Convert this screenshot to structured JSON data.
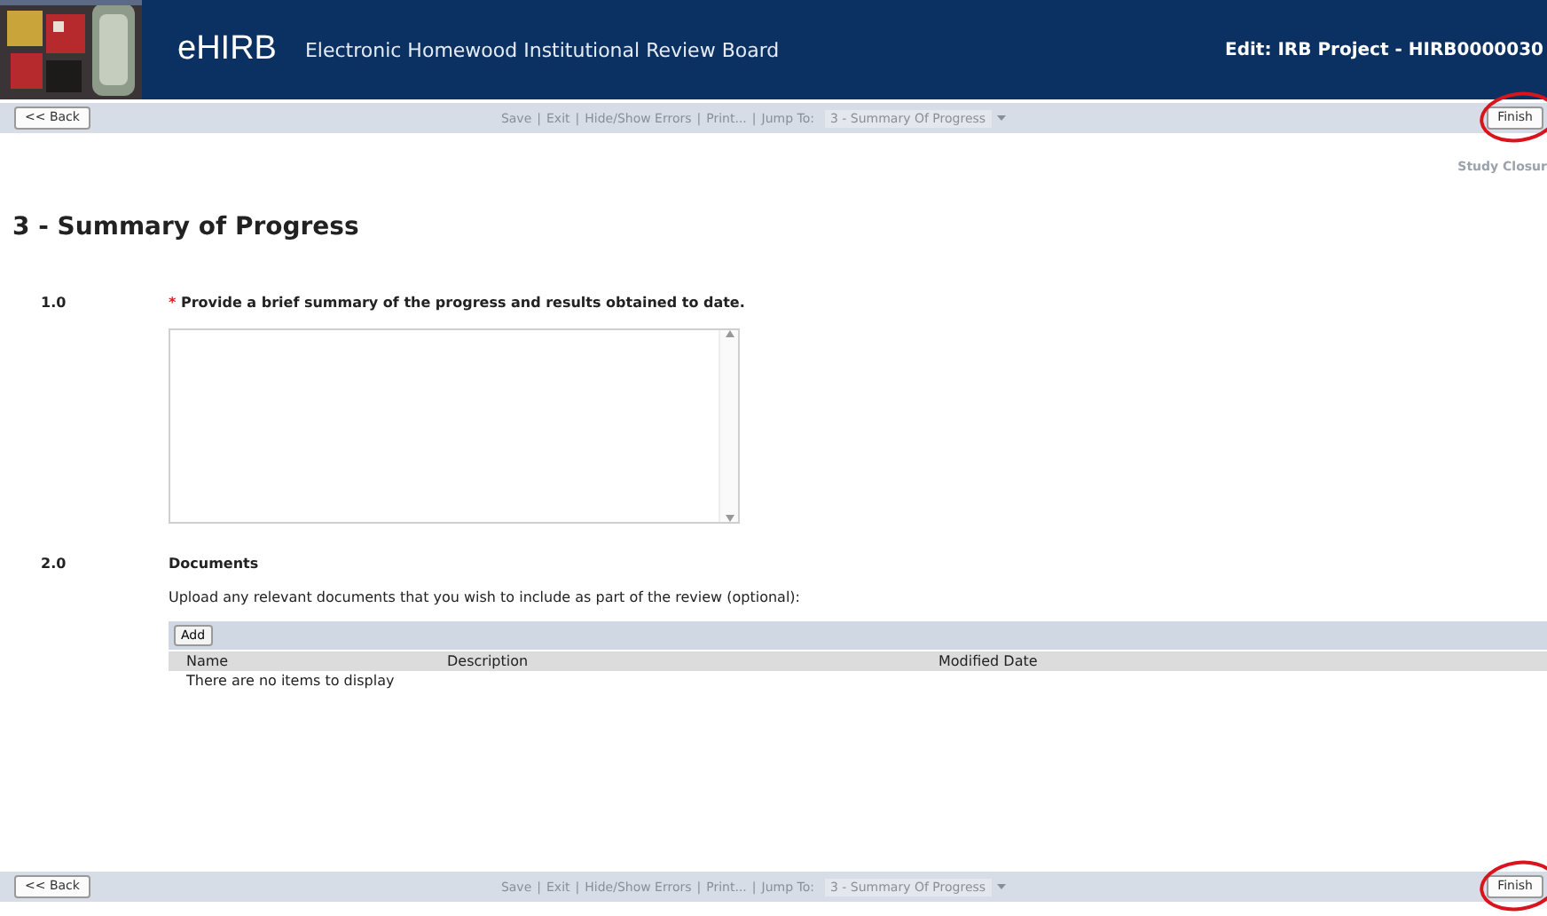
{
  "header": {
    "app_name": "eHIRB",
    "subtitle": "Electronic Homewood Institutional Review Board",
    "context": "Edit: IRB Project - HIRB0000030"
  },
  "toolbar_top": {
    "back": "<< Back",
    "links": [
      "Save",
      "Exit",
      "Hide/Show Errors",
      "Print..."
    ],
    "separator": "|",
    "jump_label": "Jump To:",
    "jump_value": "3 - Summary Of Progress",
    "finish": "Finish",
    "finish_highlighted": true
  },
  "side_note": "Study Closur",
  "page_title": "3 - Summary of Progress",
  "questions": [
    {
      "kind": "textarea",
      "number": "1.0",
      "required_mark": "*",
      "label": "Provide a brief summary of the progress and results obtained to date."
    },
    {
      "kind": "documents",
      "number": "2.0",
      "label": "Documents",
      "instructions": "Upload any relevant documents that you wish to include as part of the review (optional):",
      "add": "Add",
      "columns": [
        "Name",
        "Description",
        "Modified Date"
      ],
      "empty": "There are no items to display"
    }
  ],
  "toolbar_bottom": {
    "back": "<< Back",
    "links": [
      "Save",
      "Exit",
      "Hide/Show Errors",
      "Print..."
    ],
    "separator": "|",
    "jump_label": "Jump To:",
    "jump_value": "3 - Summary Of Progress",
    "finish": "Finish",
    "finish_highlighted": true
  }
}
